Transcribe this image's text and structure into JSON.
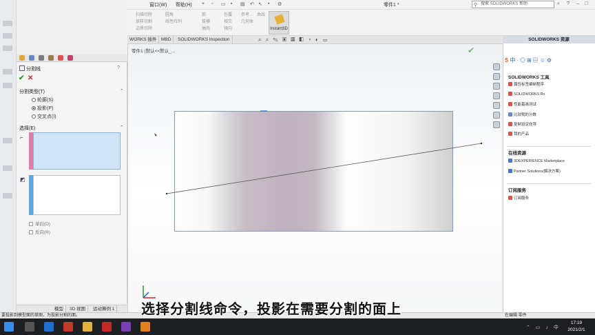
{
  "window": {
    "doc_title": "零件1 *",
    "menu": [
      "窗口(W)",
      "帮助(H)"
    ]
  },
  "search": {
    "placeholder": "搜索 SOLIDWORKS 帮助"
  },
  "ribbon": {
    "col1": [
      "扫描切除",
      "放样切割",
      "边界切除"
    ],
    "col2": [
      "圆角",
      "线性阵列"
    ],
    "col3": [
      "筋",
      "拔模",
      "抽壳"
    ],
    "col4": [
      "包覆",
      "相交",
      "镜向"
    ],
    "col5": [
      "参考...",
      "几何体"
    ],
    "col6": [
      "曲线"
    ],
    "instant3d": "Instant3D"
  },
  "cmd_tabs": [
    "WORKS 插件",
    "MBD",
    "SOLIDWORKS Inspection"
  ],
  "breadcrumb": "零件1 (默认<<默认_...",
  "property_manager": {
    "title": "分割线",
    "split_type_group": "分割类型(T)",
    "options": [
      "轮廓(S)",
      "投影(P)",
      "交叉点(I)"
    ],
    "selected_option": "投影(P)",
    "selection_group": "选择(E)",
    "checkboxes": [
      "单向(D)",
      "反向(R)"
    ]
  },
  "model_tabs": [
    "模型",
    "3D 视图",
    "运动算例 1"
  ],
  "status_bar": "要投影到模型面的草图，为投影分割的面。",
  "task_pane": {
    "header": "SOLIDWORKS 资源",
    "section1": "SOLIDWORKS 工具",
    "tools": [
      "属性标签编制程序",
      "SOLIDWORKS Rx",
      "性能基准测试",
      "比较我的分数",
      "复制设定向导",
      "我的产品"
    ],
    "section2": "在线资源",
    "online": [
      "3DEXPERIENCE Marketplace",
      "Partner Solutions(解决方案)"
    ],
    "section3": "订阅服务",
    "subscription": [
      "订阅服务"
    ],
    "footer": "在编辑 零件"
  },
  "caption": "选择分割线命令，投影在需要分割的面上",
  "clock": {
    "time": "17:19",
    "date": "2021/2/1"
  }
}
